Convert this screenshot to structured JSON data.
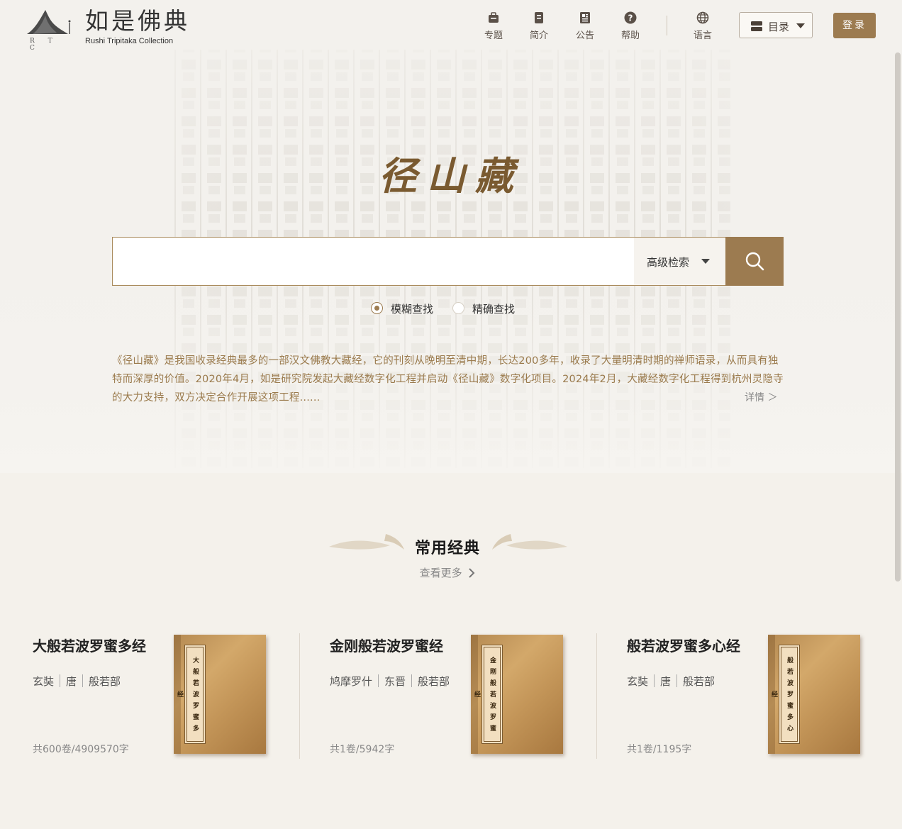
{
  "header": {
    "logo": {
      "title_cn": "如是佛典",
      "title_en": "Rushi Tripitaka Collection",
      "mark_text": "R T C"
    },
    "nav": [
      {
        "label": "专题",
        "icon": "topic-icon"
      },
      {
        "label": "简介",
        "icon": "intro-icon"
      },
      {
        "label": "公告",
        "icon": "notice-icon"
      },
      {
        "label": "帮助",
        "icon": "help-icon"
      },
      {
        "label": "语言",
        "icon": "globe-icon"
      }
    ],
    "catalog_label": "目录",
    "login_label": "登录"
  },
  "hero": {
    "title": "径山藏",
    "search": {
      "value": "",
      "placeholder": "",
      "advanced_label": "高级检索"
    },
    "modes": [
      {
        "label": "模糊查找",
        "checked": true
      },
      {
        "label": "精确查找",
        "checked": false
      }
    ],
    "intro_text": "《径山藏》是我国收录经典最多的一部汉文佛教大藏经，它的刊刻从晚明至清中期，长达200多年，收录了大量明清时期的禅师语录，从而具有独特而深厚的价值。2020年4月，如是研究院发起大藏经数字化工程并启动《径山藏》数字化项目。2024年2月，大藏经数字化工程得到杭州灵隐寺的大力支持，双方决定合作开展这项工程......",
    "more_label": "详情 ＞"
  },
  "section": {
    "title": "常用经典",
    "more_label": "查看更多"
  },
  "cards": [
    {
      "title": "大般若波罗蜜多经",
      "author": "玄奘",
      "dynasty": "唐",
      "category": "般若部",
      "count": "共600卷/4909570字",
      "cover_text": "大般若波罗蜜多经"
    },
    {
      "title": "金刚般若波罗蜜经",
      "author": "鸠摩罗什",
      "dynasty": "东晋",
      "category": "般若部",
      "count": "共1卷/5942字",
      "cover_text": "金刚般若波罗蜜经"
    },
    {
      "title": "般若波罗蜜多心经",
      "author": "玄奘",
      "dynasty": "唐",
      "category": "般若部",
      "count": "共1卷/1195字",
      "cover_text": "般若波罗蜜多心经"
    }
  ],
  "colors": {
    "accent": "#9c7b50",
    "title": "#7a5a30",
    "intro_text": "#9a7a4c"
  }
}
